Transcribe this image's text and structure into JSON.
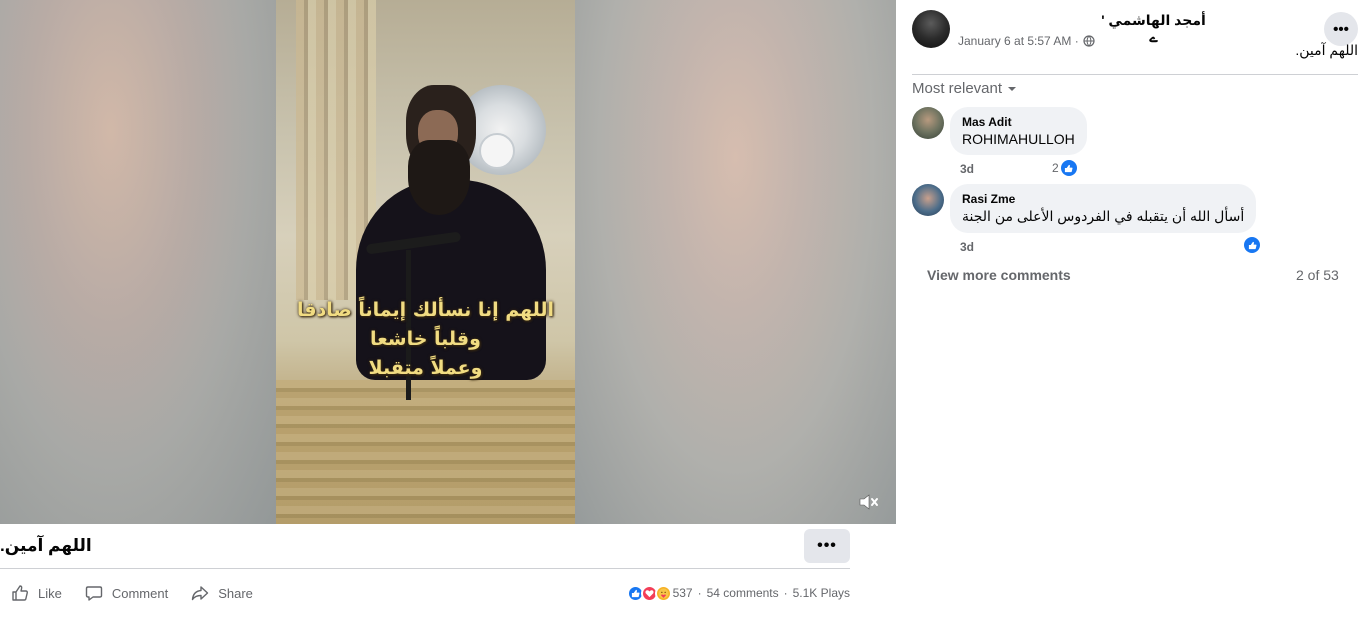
{
  "video": {
    "caption_lines": [
      "اللهم إنا نسألك إيماناً صادقا",
      "وقلباً خاشعا",
      "وعملاً متقبلا"
    ]
  },
  "post": {
    "text": "اللهم آمين.",
    "more_label": "•••",
    "actions": {
      "like": "Like",
      "comment": "Comment",
      "share": "Share"
    },
    "stats": {
      "reactions": "537",
      "comments": "54 comments",
      "plays": "5.1K Plays",
      "sep": "·"
    }
  },
  "panel": {
    "author": "أمجد الهاشمي ' ے",
    "timestamp": "January 6 at 5:57 AM ·",
    "text": "اللهم آمين.",
    "more_label": "•••",
    "sort_label": "Most relevant",
    "comments": [
      {
        "name": "Mas Adit",
        "text": "ROHIMAHULLOH",
        "time": "3d",
        "reactions": "2"
      },
      {
        "name": "Rasi Zme",
        "text": "أسأل الله أن يتقبله في الفردوس الأعلى من الجنة",
        "time": "3d",
        "reactions": ""
      }
    ],
    "view_more": "View more comments",
    "count": "2 of 53"
  },
  "icons": {
    "mute": "speaker-muted-icon",
    "like": "thumbs-up-icon",
    "comment": "speech-bubble-icon",
    "share": "share-arrow-icon",
    "globe": "globe-icon",
    "chevron": "chevron-down-icon"
  },
  "colors": {
    "accent": "#1877f2",
    "love": "#f33e58",
    "care": "#f7b125",
    "caption": "#f1dc82"
  }
}
